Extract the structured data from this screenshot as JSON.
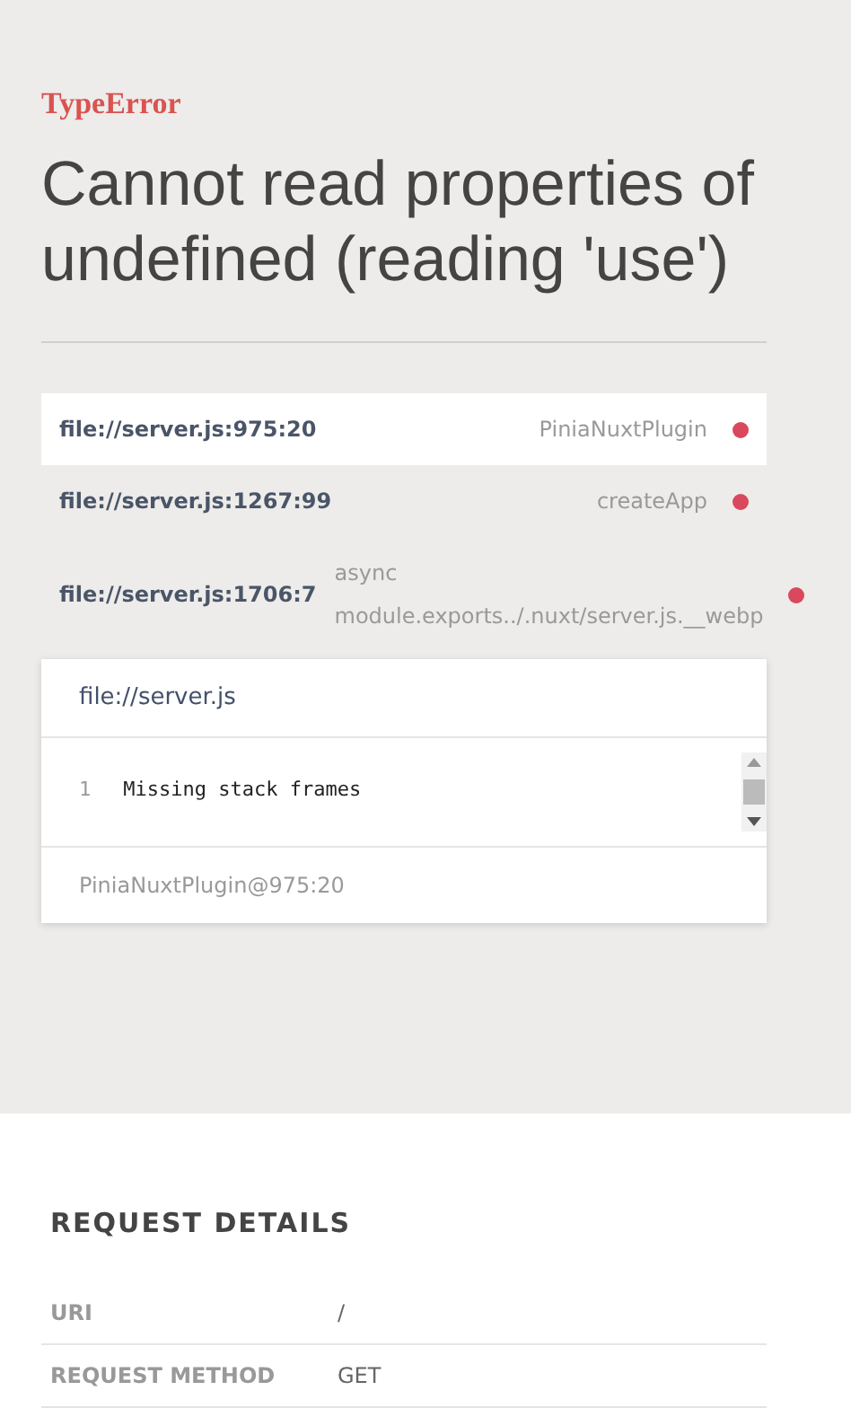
{
  "error": {
    "type": "TypeError",
    "message": "Cannot read properties of undefined (reading 'use')"
  },
  "frames": [
    {
      "location": "file://server.js:975:20",
      "function": "PiniaNuxtPlugin",
      "selected": true
    },
    {
      "location": "file://server.js:1267:99",
      "function": "createApp",
      "selected": false
    },
    {
      "location": "file://server.js:1706:7",
      "function": "async module.exports../.nuxt/server.js.__webp",
      "selected": false
    }
  ],
  "code_panel": {
    "file": "file://server.js",
    "lines": [
      {
        "number": "1",
        "text": "Missing stack frames"
      }
    ],
    "footer": "PiniaNuxtPlugin@975:20"
  },
  "request_details": {
    "title": "REQUEST DETAILS",
    "rows": [
      {
        "label": "URI",
        "value": "/"
      },
      {
        "label": "REQUEST METHOD",
        "value": "GET"
      }
    ]
  }
}
